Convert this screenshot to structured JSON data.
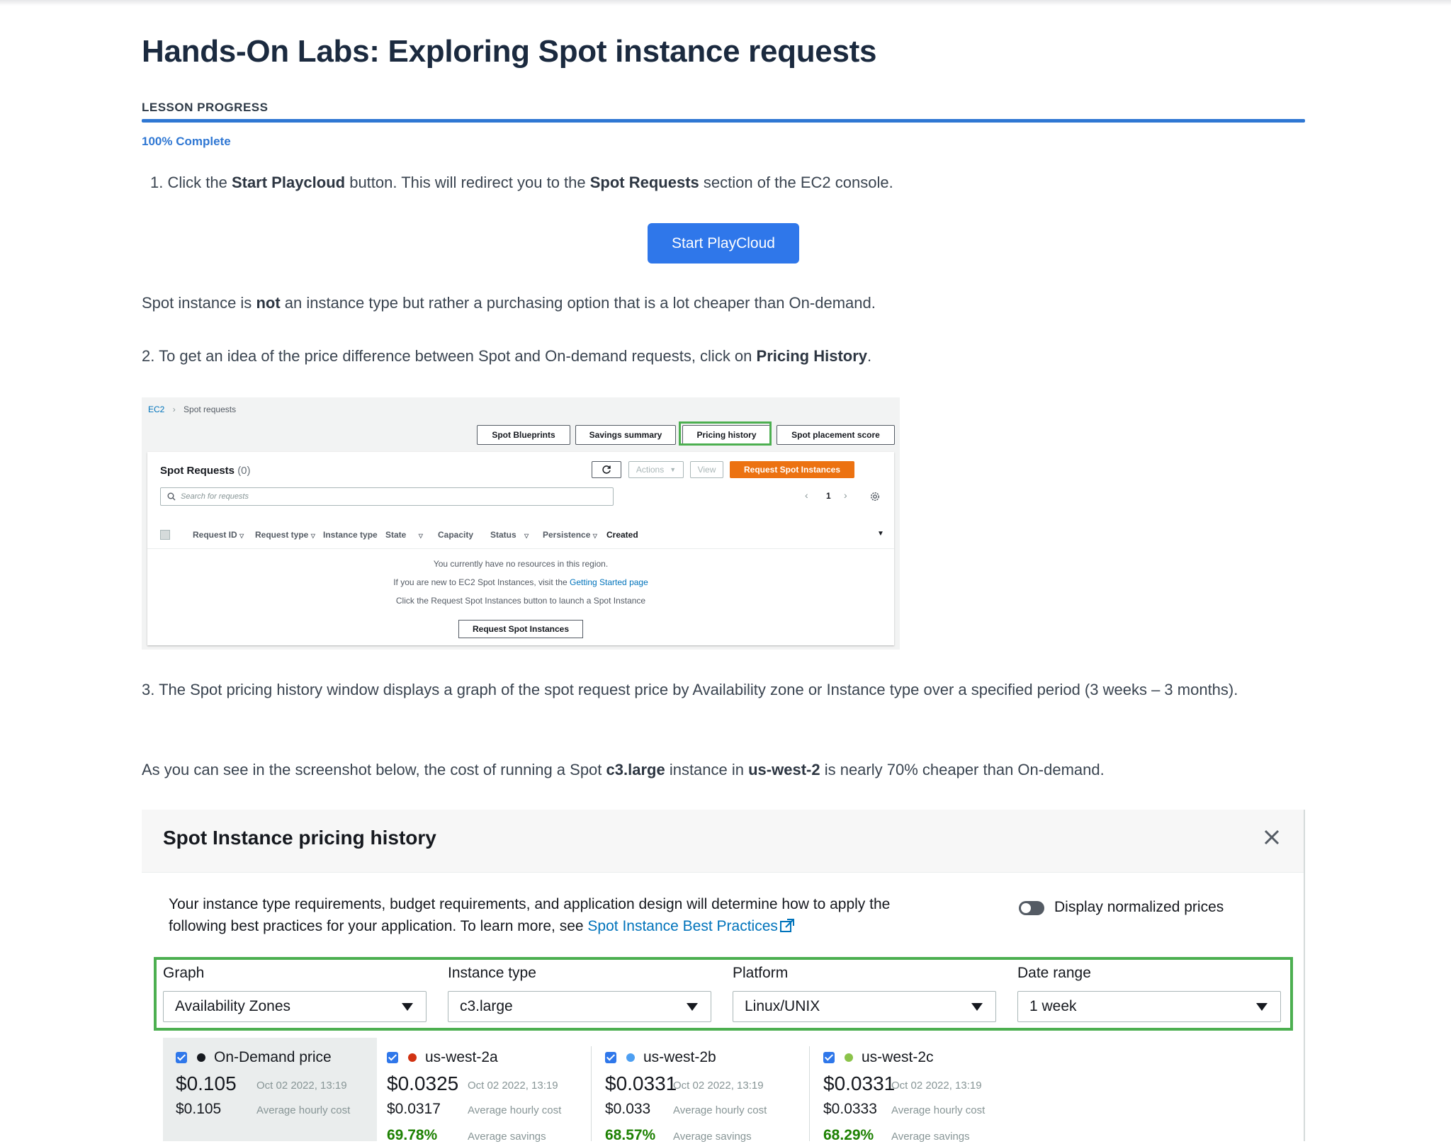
{
  "page": {
    "title": "Hands-On Labs: Exploring Spot instance requests",
    "progress_label": "LESSON PROGRESS",
    "progress_percent": 100,
    "progress_text": "100% Complete"
  },
  "steps": {
    "step1_prefix": "1. Click the ",
    "step1_b1": "Start Playcloud",
    "step1_mid": " button. This will redirect you to the ",
    "step1_b2": "Spot Requests",
    "step1_suffix": " section of the EC2 console.",
    "start_button": "Start PlayCloud",
    "spot_note_prefix": "Spot instance is ",
    "spot_note_bold": "not",
    "spot_note_suffix": " an instance type but rather a purchasing option that is a lot cheaper than On-demand.",
    "step2_prefix": "2. To get an idea of the price difference between Spot and On-demand requests, click on ",
    "step2_bold": "Pricing History",
    "step2_suffix": ".",
    "step3": "3. The Spot pricing history window displays a graph of the spot request price by Availability zone or Instance type over a specified period (3 weeks – 3 months).",
    "cost_prefix": "As you can see in the screenshot below, the cost of running a Spot ",
    "cost_b1": "c3.large",
    "cost_mid": " instance in ",
    "cost_b2": "us-west-2",
    "cost_suffix": " is nearly 70% cheaper than On-demand."
  },
  "spot_console": {
    "breadcrumb_root": "EC2",
    "breadcrumb_current": "Spot requests",
    "tabs": [
      "Spot Blueprints",
      "Savings summary",
      "Pricing history",
      "Spot placement score"
    ],
    "panel_title": "Spot Requests",
    "panel_count": "(0)",
    "actions_label": "Actions",
    "view_label": "View",
    "request_button": "Request Spot Instances",
    "search_placeholder": "Search for requests",
    "page_number": "1",
    "columns": [
      "Request ID",
      "Request type",
      "Instance type",
      "State",
      "Capacity",
      "Status",
      "Persistence",
      "Created"
    ],
    "empty_line1": "You currently have no resources in this region.",
    "empty_line2_prefix": "If you are new to EC2 Spot Instances, visit the ",
    "empty_line2_link": "Getting Started page",
    "empty_line3": "Click the Request Spot Instances button to launch a Spot Instance",
    "empty_button": "Request Spot Instances"
  },
  "pricing_modal": {
    "title": "Spot Instance pricing history",
    "desc_line1": "Your instance type requirements, budget requirements, and application design will determine how to apply the",
    "desc_line2_prefix": "following best practices for your application. To learn more, see ",
    "desc_link": "Spot Instance Best Practices",
    "toggle_label": "Display normalized prices",
    "toggle_on": false,
    "filters": [
      {
        "label": "Graph",
        "value": "Availability Zones"
      },
      {
        "label": "Instance type",
        "value": "c3.large"
      },
      {
        "label": "Platform",
        "value": "Linux/UNIX"
      },
      {
        "label": "Date range",
        "value": "1 week"
      }
    ],
    "legend": [
      {
        "name": "On-Demand price",
        "color": "#16191f",
        "price": "$0.105",
        "date": "Oct 02 2022, 13:19",
        "avg": "$0.105",
        "avg_label": "Average hourly cost"
      },
      {
        "name": "us-west-2a",
        "color": "#d13212",
        "price": "$0.0325",
        "date": "Oct 02 2022, 13:19",
        "avg": "$0.0317",
        "avg_label": "Average hourly cost",
        "savings": "69.78%",
        "savings_label": "Average savings"
      },
      {
        "name": "us-west-2b",
        "color": "#4d9ff2",
        "price": "$0.0331",
        "date": "Oct 02 2022, 13:19",
        "avg": "$0.033",
        "avg_label": "Average hourly cost",
        "savings": "68.57%",
        "savings_label": "Average savings"
      },
      {
        "name": "us-west-2c",
        "color": "#8bc34a",
        "price": "$0.0331",
        "date": "Oct 02 2022, 13:19",
        "avg": "$0.0333",
        "avg_label": "Average hourly cost",
        "savings": "68.29%",
        "savings_label": "Average savings"
      }
    ]
  }
}
